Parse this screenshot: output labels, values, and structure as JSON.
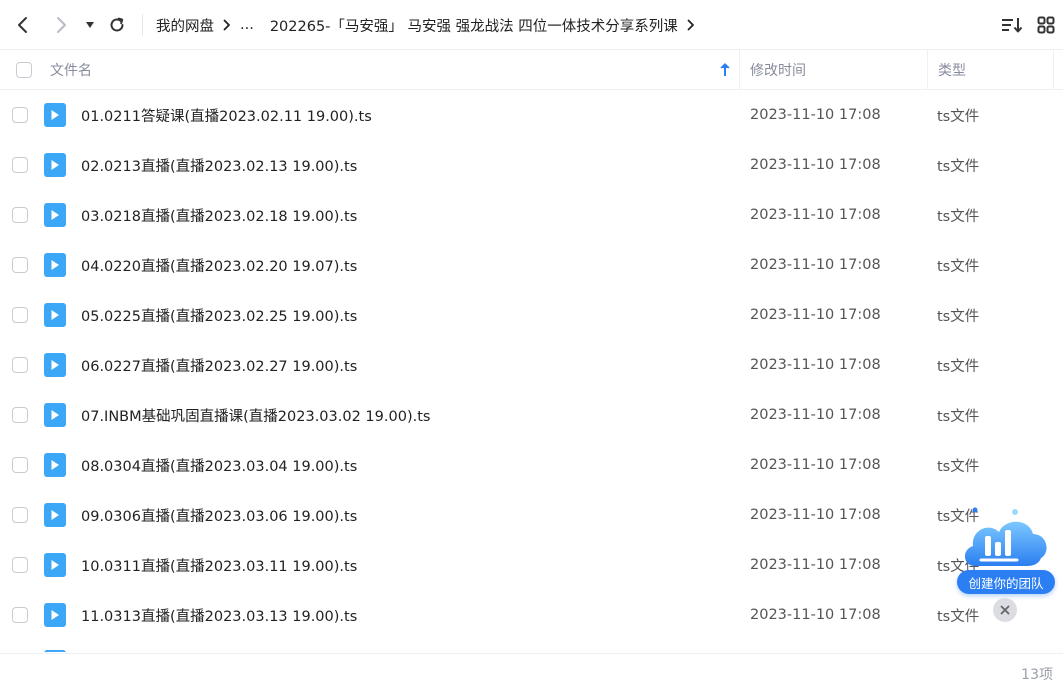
{
  "toolbar": {
    "breadcrumbs": [
      {
        "label": "我的网盘"
      },
      {
        "label": "..."
      },
      {
        "label": "202265-「马安强」 马安强 强龙战法 四位一体技术分享系列课"
      }
    ]
  },
  "icons": {
    "back": "chevron-left-icon",
    "forward": "chevron-right-icon",
    "dropdown": "caret-down-icon",
    "refresh": "refresh-icon",
    "sort": "sort-list-icon",
    "grid": "grid-view-icon",
    "file": "video-file-icon"
  },
  "table": {
    "headers": {
      "name": "文件名",
      "modified": "修改时间",
      "type": "类型"
    },
    "rows": [
      {
        "name": "01.0211答疑课(直播2023.02.11 19.00).ts",
        "modified": "2023-11-10 17:08",
        "type": "ts文件"
      },
      {
        "name": "02.0213直播(直播2023.02.13 19.00).ts",
        "modified": "2023-11-10 17:08",
        "type": "ts文件"
      },
      {
        "name": "03.0218直播(直播2023.02.18 19.00).ts",
        "modified": "2023-11-10 17:08",
        "type": "ts文件"
      },
      {
        "name": "04.0220直播(直播2023.02.20 19.07).ts",
        "modified": "2023-11-10 17:08",
        "type": "ts文件"
      },
      {
        "name": "05.0225直播(直播2023.02.25 19.00).ts",
        "modified": "2023-11-10 17:08",
        "type": "ts文件"
      },
      {
        "name": "06.0227直播(直播2023.02.27 19.00).ts",
        "modified": "2023-11-10 17:08",
        "type": "ts文件"
      },
      {
        "name": "07.INBM基础巩固直播课(直播2023.03.02 19.00).ts",
        "modified": "2023-11-10 17:08",
        "type": "ts文件"
      },
      {
        "name": "08.0304直播(直播2023.03.04 19.00).ts",
        "modified": "2023-11-10 17:08",
        "type": "ts文件"
      },
      {
        "name": "09.0306直播(直播2023.03.06 19.00).ts",
        "modified": "2023-11-10 17:08",
        "type": "ts文件"
      },
      {
        "name": "10.0311直播(直播2023.03.11 19.00).ts",
        "modified": "2023-11-10 17:08",
        "type": "ts文件"
      },
      {
        "name": "11.0313直播(直播2023.03.13 19.00).ts",
        "modified": "2023-11-10 17:08",
        "type": "ts文件"
      }
    ]
  },
  "footer": {
    "count": "13项"
  },
  "team_widget": {
    "label": "创建你的团队"
  },
  "colors": {
    "accent": "#3ca6f7",
    "widget_blue": "#2c7ff2"
  }
}
